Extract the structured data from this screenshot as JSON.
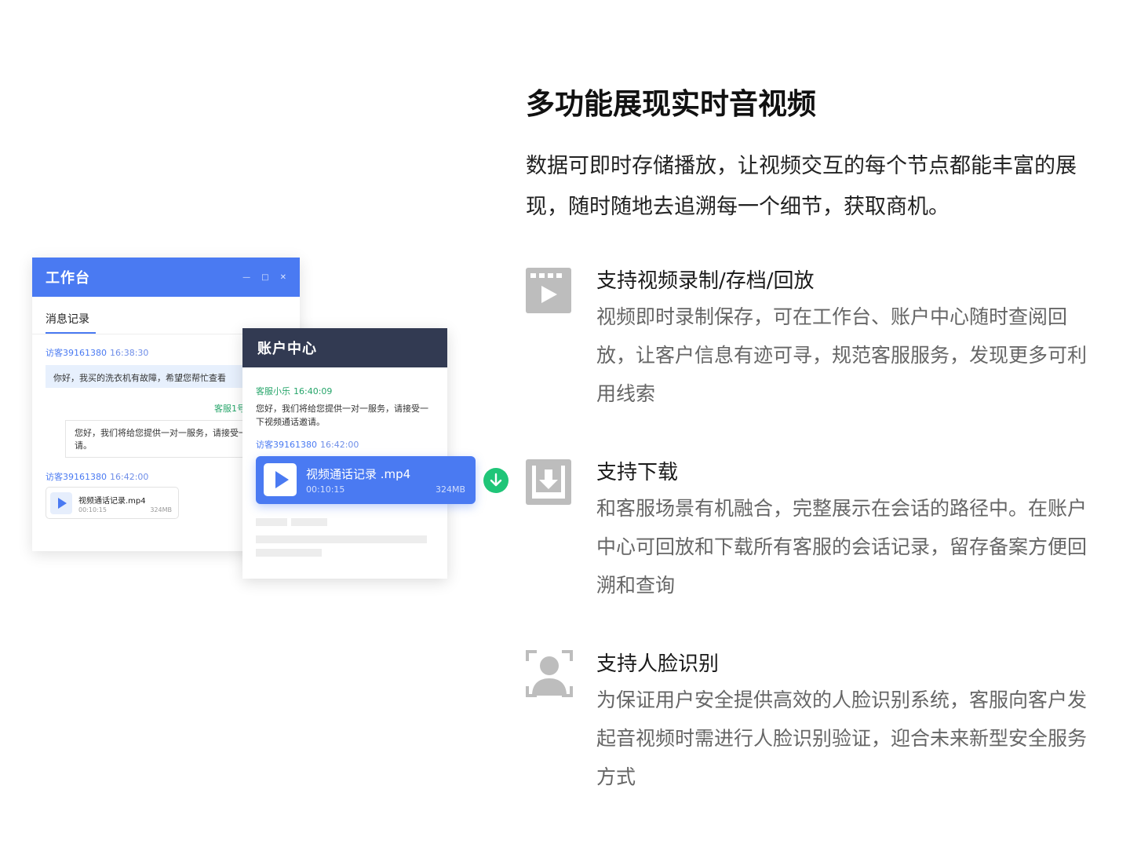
{
  "workbench": {
    "title": "工作台",
    "window_controls": [
      "—",
      "□",
      "✕"
    ],
    "tab": "消息记录",
    "visitor_msg": {
      "name": "访客39161380",
      "time": "16:38:30",
      "text": "你好，我买的洗衣机有故障，希望您帮忙查看"
    },
    "agent_label": "客服1号",
    "agent_msg": "您好，我们将给您提供一对一服务，请接受一下视频通话邀请。",
    "visitor2": {
      "name": "访客39161380",
      "time": "16:42:00"
    },
    "file": {
      "name": "视频通话记录.mp4",
      "duration": "00:10:15",
      "size": "324MB"
    }
  },
  "account_center": {
    "title": "账户中心",
    "agent": {
      "name": "客服小乐",
      "time": "16:40:09"
    },
    "agent_msg": "您好，我们将给您提供一对一服务，请接受一下视频通话邀请。",
    "visitor": {
      "name": "访客39161380",
      "time": "16:42:00"
    },
    "video": {
      "name": "视频通话记录 .mp4",
      "duration": "00:10:15",
      "size": "324MB"
    }
  },
  "headline": "多功能展现实时音视频",
  "description": "数据可即时存储播放，让视频交互的每个节点都能丰富的展现，随时随地去追溯每一个细节，获取商机。",
  "features": [
    {
      "icon": "video-film-icon",
      "title": "支持视频录制/存档/回放",
      "desc": "视频即时录制保存，可在工作台、账户中心随时查阅回放，让客户信息有迹可寻，规范客服服务，发现更多可利用线索"
    },
    {
      "icon": "download-box-icon",
      "title": "支持下载",
      "desc": "和客服场景有机融合，完整展示在会话的路径中。在账户中心可回放和下载所有客服的会话记录，留存备案方便回溯和查询"
    },
    {
      "icon": "face-scan-icon",
      "title": "支持人脸识别",
      "desc": "为保证用户安全提供高效的人脸识别系统，客服向客户发起音视频时需进行人脸识别验证，迎合未来新型安全服务方式"
    }
  ],
  "colors": {
    "accent": "#4a7af2",
    "dark_header": "#323a52",
    "green": "#1fc578",
    "icon_gray": "#bdbdbd"
  }
}
